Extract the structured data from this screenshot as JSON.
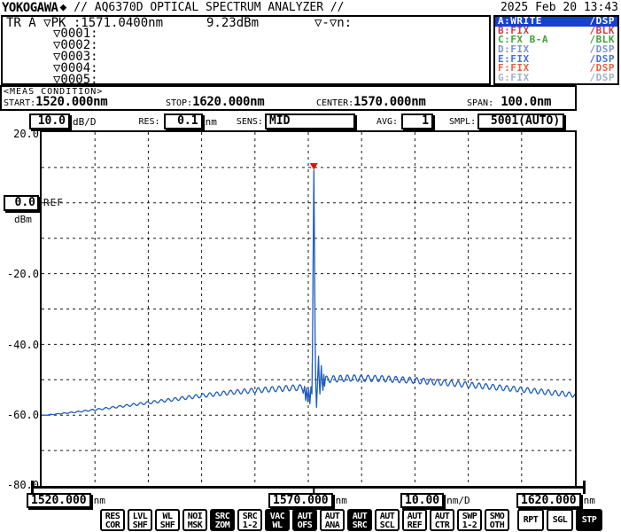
{
  "header": {
    "brand": "YOKOGAWA",
    "brand_mark": "◆",
    "title": "// AQ6370D OPTICAL SPECTRUM ANALYZER //",
    "datetime": "2025 Feb 20 13:43"
  },
  "trace_info": {
    "peak_readout": "TR A ▽PK :1571.0400nm",
    "peak_level": "9.23dBm",
    "delta_label": "▽-▽n:",
    "markers": [
      "▽0001:",
      "▽0002:",
      "▽0003:",
      "▽0004:",
      "▽0005:"
    ]
  },
  "trace_panel": {
    "rows": [
      {
        "name": "A:WRITE",
        "mode": "/DSP",
        "color": "#ffffff",
        "bg": "#1540d0",
        "selected": true
      },
      {
        "name": "B:FIX",
        "mode": "/BLK",
        "color": "#c94040"
      },
      {
        "name": "C:FX B-A",
        "mode": "/BLK",
        "color": "#3aa53a"
      },
      {
        "name": "D:FIX",
        "mode": "/DSP",
        "color": "#8093c6"
      },
      {
        "name": "E:FIX",
        "mode": "/DSP",
        "color": "#4272cf"
      },
      {
        "name": "F:FIX",
        "mode": "/DSP",
        "color": "#e8613f"
      },
      {
        "name": "G:FIX",
        "mode": "/DSP",
        "color": "#9fb2c8"
      }
    ]
  },
  "meas_condition": {
    "title": "<MEAS CONDITION>",
    "fields": [
      {
        "label": "START:",
        "value": "1520.000",
        "unit": "nm"
      },
      {
        "label": "STOP:",
        "value": "1620.000",
        "unit": "nm"
      },
      {
        "label": "CENTER:",
        "value": "1570.000",
        "unit": "nm"
      },
      {
        "label": "SPAN:",
        "value": " 100.0",
        "unit": "nm"
      }
    ]
  },
  "settings": {
    "scale": {
      "value": "10.0",
      "unit": "dB/D"
    },
    "res": {
      "label": "RES:",
      "value": "0.1",
      "unit": "nm"
    },
    "sens": {
      "label": "SENS:",
      "value": "MID"
    },
    "avg": {
      "label": "AVG:",
      "value": "1"
    },
    "smpl": {
      "label": "SMPL:",
      "value": "5001(AUTO)"
    }
  },
  "y_axis": {
    "top": "20.0",
    "labels": [
      "-20.0",
      "-40.0",
      "-60.0",
      "-80.0"
    ],
    "ref": {
      "value": "0.0",
      "unit": "dBm",
      "label": "REF"
    }
  },
  "x_axis": {
    "start": {
      "value": "1520.000",
      "unit": "nm"
    },
    "center": {
      "value": "1570.000",
      "unit": "nm"
    },
    "per_div": {
      "value": "10.00",
      "unit": "nm/D"
    },
    "stop": {
      "value": "1620.000",
      "unit": "nm"
    }
  },
  "toolbar": {
    "buttons": [
      {
        "lines": [
          "RES",
          "COR"
        ],
        "inverted": false
      },
      {
        "lines": [
          "LVL",
          "SHF"
        ],
        "inverted": false
      },
      {
        "lines": [
          "WL",
          "SHF"
        ],
        "inverted": false
      },
      {
        "lines": [
          "NOI",
          "MSK"
        ],
        "inverted": false
      },
      {
        "lines": [
          "SRC",
          "ZOM"
        ],
        "inverted": true
      },
      {
        "lines": [
          "SRC",
          "1-2"
        ],
        "inverted": false
      },
      {
        "lines": [
          "VAC",
          "WL"
        ],
        "inverted": true
      },
      {
        "lines": [
          "AUT",
          "OFS"
        ],
        "inverted": true
      },
      {
        "lines": [
          "AUT",
          "ANA"
        ],
        "inverted": false
      },
      {
        "lines": [
          "AUT",
          "SRC"
        ],
        "inverted": true
      },
      {
        "lines": [
          "AUT",
          "SCL"
        ],
        "inverted": false
      },
      {
        "lines": [
          "AUT",
          "REF"
        ],
        "inverted": false
      },
      {
        "lines": [
          "AUT",
          "CTR"
        ],
        "inverted": false
      },
      {
        "lines": [
          "SWP",
          "1-2"
        ],
        "inverted": false
      },
      {
        "lines": [
          "SMO",
          "OTH"
        ],
        "inverted": false
      },
      {
        "lines": [
          "RPT"
        ],
        "inverted": false
      },
      {
        "lines": [
          "SGL"
        ],
        "inverted": false
      },
      {
        "lines": [
          "STP"
        ],
        "inverted": true
      }
    ]
  },
  "chart_data": {
    "type": "line",
    "x_unit": "nm",
    "y_unit": "dBm",
    "x_range": [
      1520,
      1620
    ],
    "y_range": [
      -80,
      20
    ],
    "x_grid_step_nm": 10,
    "y_grid_step_db": 10,
    "ref_level_dbm": 0.0,
    "trace_color": "#1f5cc0",
    "marker_color": "#e01010",
    "peak_marker": {
      "wavelength_nm": 1571.04,
      "level_dbm": 9.23
    },
    "sample_step_nm": 0.12,
    "ripple_period_nm": 1.3,
    "left_section": {
      "end_nm": 1568.9,
      "ripple_amp_db": [
        0.05,
        0.85
      ],
      "envelope": [
        [
          1520,
          -60.1
        ],
        [
          1526,
          -59.2
        ],
        [
          1532,
          -58.1
        ],
        [
          1538,
          -56.9
        ],
        [
          1544,
          -55.7
        ],
        [
          1550,
          -54.5
        ],
        [
          1556,
          -53.5
        ],
        [
          1562,
          -52.8
        ],
        [
          1567,
          -52.3
        ],
        [
          1568.9,
          -52.2
        ]
      ]
    },
    "peak_points": [
      [
        1569.05,
        -53.8
      ],
      [
        1569.3,
        -51.8
      ],
      [
        1569.5,
        -55.8
      ],
      [
        1569.7,
        -52.3
      ],
      [
        1569.9,
        -56.3
      ],
      [
        1570.1,
        -52.8
      ],
      [
        1570.3,
        -56.8
      ],
      [
        1570.5,
        -52.0
      ],
      [
        1570.68,
        -54.0
      ],
      [
        1570.8,
        -40.0
      ],
      [
        1570.92,
        -15.0
      ],
      [
        1571.04,
        9.23
      ],
      [
        1571.16,
        -12.0
      ],
      [
        1571.28,
        -38.0
      ],
      [
        1571.42,
        -52.0
      ],
      [
        1571.55,
        -57.8
      ],
      [
        1571.7,
        -52.0
      ],
      [
        1571.82,
        -47.0
      ],
      [
        1571.92,
        -43.3
      ],
      [
        1572.05,
        -50.0
      ],
      [
        1572.18,
        -54.0
      ],
      [
        1572.32,
        -49.5
      ],
      [
        1572.45,
        -46.0
      ],
      [
        1572.6,
        -51.0
      ],
      [
        1572.75,
        -53.0
      ],
      [
        1572.9,
        -48.5
      ],
      [
        1573.05,
        -51.8
      ],
      [
        1573.2,
        -49.6
      ]
    ],
    "right_section": {
      "start_nm": 1573.3,
      "ripple_amp_db": [
        0.95,
        0.7
      ],
      "envelope": [
        [
          1573.3,
          -49.9
        ],
        [
          1578,
          -49.5
        ],
        [
          1584,
          -49.7
        ],
        [
          1590,
          -50.2
        ],
        [
          1596,
          -50.9
        ],
        [
          1602,
          -51.7
        ],
        [
          1608,
          -52.5
        ],
        [
          1614,
          -53.4
        ],
        [
          1620,
          -54.3
        ]
      ]
    }
  }
}
